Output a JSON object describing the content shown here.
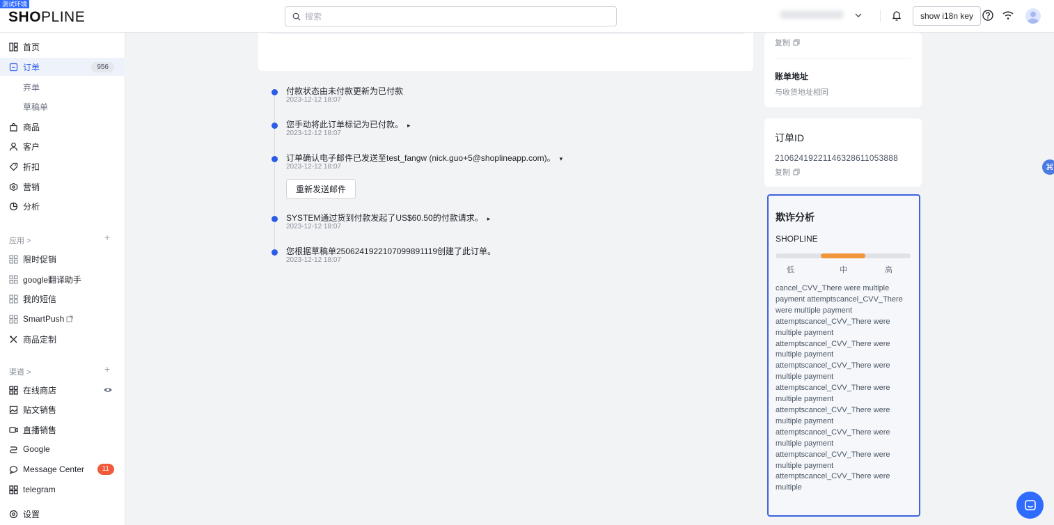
{
  "env_badge": "测试环境",
  "logo": {
    "bold": "SH",
    "mark": "O",
    "rest": "PLINE"
  },
  "header": {
    "search_placeholder": "搜索",
    "i18n_button": "show i18n key"
  },
  "sidebar": {
    "items": [
      {
        "label": "首页",
        "icon": "home-icon"
      },
      {
        "label": "订单",
        "icon": "order-icon",
        "count": "956"
      },
      {
        "label": "弃单"
      },
      {
        "label": "草稿单"
      },
      {
        "label": "商品",
        "icon": "bag-icon"
      },
      {
        "label": "客户",
        "icon": "user-icon"
      },
      {
        "label": "折扣",
        "icon": "tag-icon"
      },
      {
        "label": "营销",
        "icon": "target-icon"
      },
      {
        "label": "分析",
        "icon": "chart-icon"
      }
    ],
    "apps_label": "应用 >",
    "apps": [
      {
        "label": "限时促销"
      },
      {
        "label": "google翻译助手"
      },
      {
        "label": "我的短信"
      },
      {
        "label": "SmartPush"
      },
      {
        "label": "商品定制"
      }
    ],
    "channels_label": "渠道 >",
    "channels": [
      {
        "label": "在线商店"
      },
      {
        "label": "贴文销售"
      },
      {
        "label": "直播销售"
      },
      {
        "label": "Google"
      },
      {
        "label": "Message Center",
        "count": "11"
      },
      {
        "label": "telegram"
      }
    ],
    "settings": "设置"
  },
  "timeline": [
    {
      "text": "付款状态由未付款更新为已付款",
      "time": "2023-12-12 18:07"
    },
    {
      "text": "您手动将此订单标记为已付款。",
      "time": "2023-12-12 18:07",
      "caret": "▸"
    },
    {
      "text": "订单确认电子邮件已发送至test_fangw (nick.guo+5@shoplineapp.com)。",
      "time": "2023-12-12 18:07",
      "caret": "▾",
      "button": "重新发送邮件"
    },
    {
      "text": "SYSTEM通过货到付款发起了US$60.50的付款请求。",
      "time": "2023-12-12 18:07",
      "caret": "▸"
    },
    {
      "text": "您根据草稿单2506241922107099891119创建了此订单。",
      "time": "2023-12-12 18:07"
    }
  ],
  "right": {
    "copy_label": "复制",
    "billing_title": "账单地址",
    "billing_value": "与收货地址相同",
    "order_id_title": "订单ID",
    "order_id_value": "21062419221146328611053888",
    "fraud": {
      "title": "欺诈分析",
      "provider": "SHOPLINE",
      "risk_level": 0.5,
      "risk_labels": [
        "低",
        "中",
        "高"
      ],
      "accent_color": "#f2963a",
      "description": "cancel_CVV_There were multiple payment attemptscancel_CVV_There were multiple payment attemptscancel_CVV_There were multiple payment attemptscancel_CVV_There were multiple payment attemptscancel_CVV_There were multiple payment attemptscancel_CVV_There were multiple payment attemptscancel_CVV_There were multiple payment attemptscancel_CVV_There were multiple payment attemptscancel_CVV_There were multiple payment attemptscancel_CVV_There were multiple"
    }
  },
  "colors": {
    "brand": "#2b5ce6",
    "alert": "#f05a3a"
  }
}
